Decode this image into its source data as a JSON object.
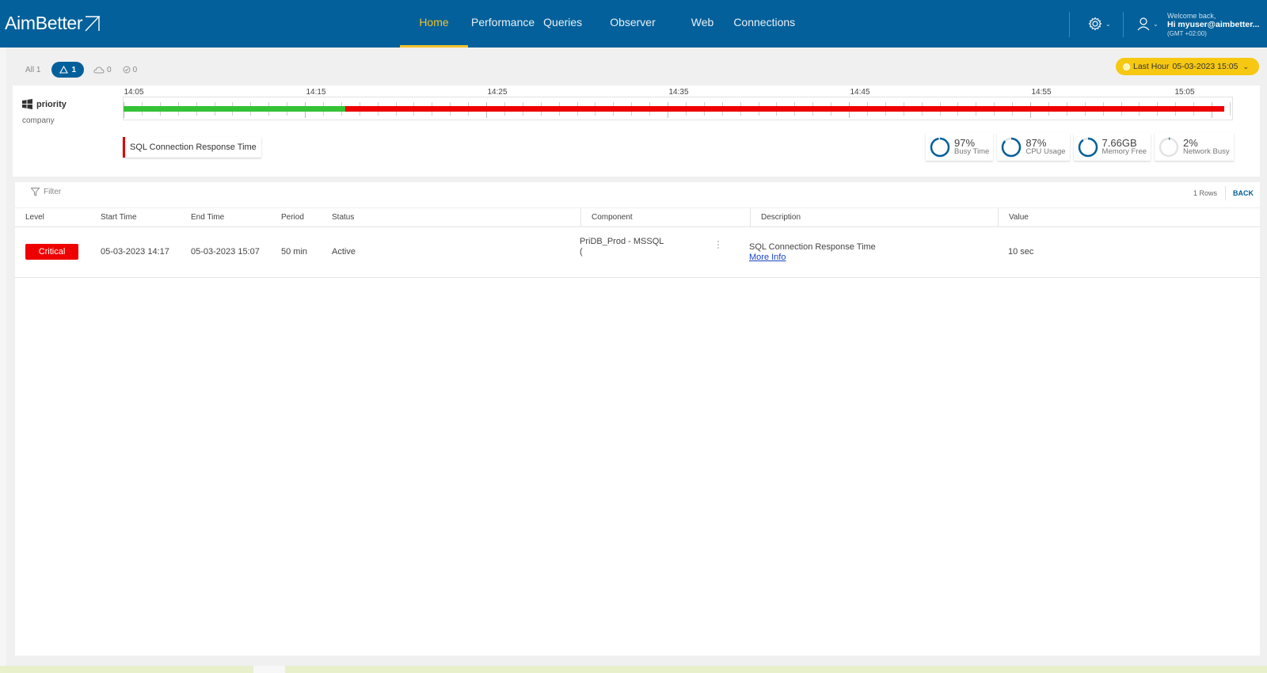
{
  "header": {
    "logo_text": "AimBetter",
    "nav": [
      "Home",
      "Performance",
      "Queries",
      "Observer",
      "Web",
      "Connections"
    ],
    "active_nav": "Home",
    "user": {
      "welcome": "Welcome back,",
      "name": "Hi myuser@aimbetter...",
      "timezone": "(GMT +02:00)"
    }
  },
  "counts": {
    "all": "All 1",
    "alerts": "1",
    "cloud": "0",
    "resolved": "0"
  },
  "time_range": {
    "label": "Last Hour",
    "date": "05-03-2023 15:05"
  },
  "server": {
    "name": "priority",
    "subtitle": "company"
  },
  "timeline": {
    "tick_labels": [
      "14:05",
      "14:15",
      "14:25",
      "14:35",
      "14:45",
      "14:55",
      "15:05"
    ],
    "healthy_fraction": 0.2,
    "status_colors": {
      "ok": "#35c235",
      "critical": "#ee0000"
    }
  },
  "alarm_tag": "SQL Connection Response Time",
  "kpis": [
    {
      "value": "97%",
      "label": "Busy Time",
      "fraction": 0.97
    },
    {
      "value": "87%",
      "label": "CPU Usage",
      "fraction": 0.87
    },
    {
      "value": "7.66GB",
      "label": "Memory Free",
      "fraction": 0.9
    },
    {
      "value": "2%",
      "label": "Network Busy",
      "fraction": 0.02
    }
  ],
  "table": {
    "filter_label": "Filter",
    "rows_count": "1 Rows",
    "back_label": "BACK",
    "columns": [
      "Level",
      "Start Time",
      "End Time",
      "Period",
      "Status",
      "Component",
      "Description",
      "Value"
    ],
    "rows": [
      {
        "level": "Critical",
        "start": "05-03-2023 14:17",
        "end": "05-03-2023 15:07",
        "period": "50 min",
        "status": "Active",
        "component_line1": "PriDB_Prod - MSSQL",
        "component_line2": "(",
        "description": "SQL Connection Response Time",
        "more_info": "More Info",
        "value": "10 sec"
      }
    ]
  },
  "colors": {
    "brand": "#03609a",
    "accent": "#f6c12b",
    "critical": "#ee0000"
  }
}
